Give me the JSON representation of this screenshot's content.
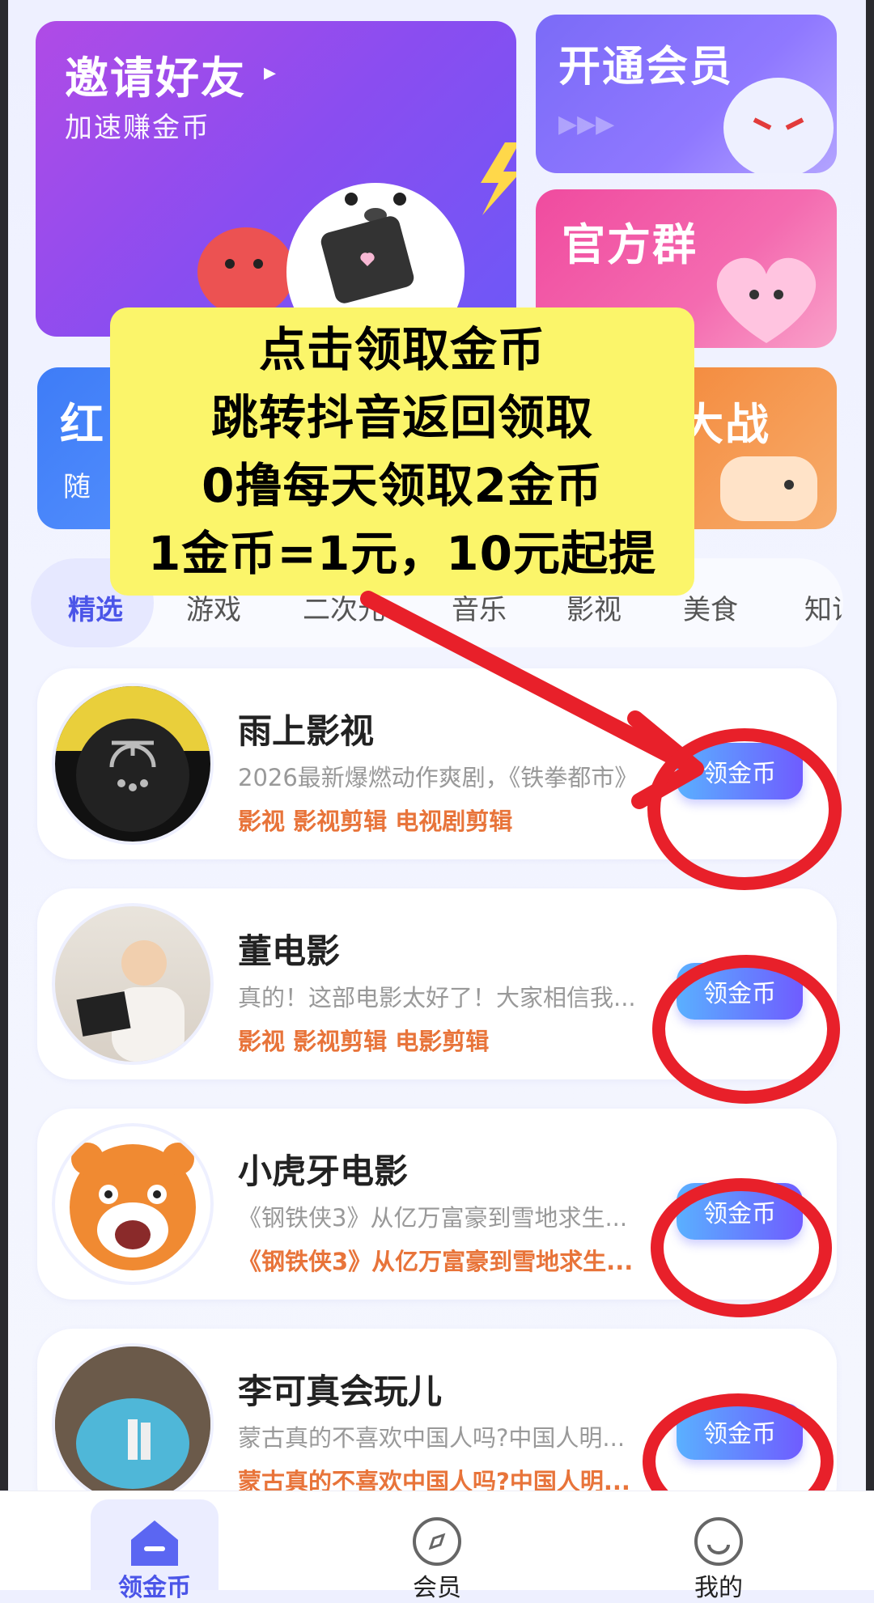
{
  "banners": {
    "invite": {
      "title": "邀请好友",
      "subtitle": "加速赚金币"
    },
    "vip": {
      "title": "开通会员"
    },
    "group": {
      "title": "官方群"
    },
    "red": {
      "title_partial": "红",
      "sub_partial": "随"
    },
    "battle": {
      "title_partial": "大战"
    }
  },
  "promo": {
    "lines": [
      "点击领取金币",
      "跳转抖音返回领取",
      "0撸每天领取2金币",
      "1金币=1元，10元起提"
    ]
  },
  "tabs": [
    "精选",
    "游戏",
    "二次元",
    "音乐",
    "影视",
    "美食",
    "知识"
  ],
  "active_tab": "精选",
  "list": [
    {
      "title": "雨上影视",
      "desc": "2026最新爆燃动作爽剧，《铁拳都市》",
      "tags": "影视  影视剪辑  电视剧剪辑",
      "button": "领金币"
    },
    {
      "title": "董电影",
      "desc": "真的！这部电影太好了！大家相信我...",
      "tags": "影视  影视剪辑  电影剪辑",
      "button": "领金币"
    },
    {
      "title": "小虎牙电影",
      "desc": "《钢铁侠3》从亿万富豪到雪地求生...",
      "tags": "《钢铁侠3》从亿万富豪到雪地求生...",
      "button": "领金币"
    },
    {
      "title": "李可真会玩儿",
      "desc": "蒙古真的不喜欢中国人吗?中国人明...",
      "tags": "蒙古真的不喜欢中国人吗?中国人明...",
      "button": "领金币"
    }
  ],
  "nav": [
    {
      "label": "领金币",
      "icon": "coin-home-icon"
    },
    {
      "label": "会员",
      "icon": "compass-icon"
    },
    {
      "label": "我的",
      "icon": "smile-icon"
    }
  ],
  "colors": {
    "accent": "#4b55e8",
    "tag": "#e8743a",
    "promo_bg": "#fbf56a",
    "annotation": "#e8202a"
  }
}
